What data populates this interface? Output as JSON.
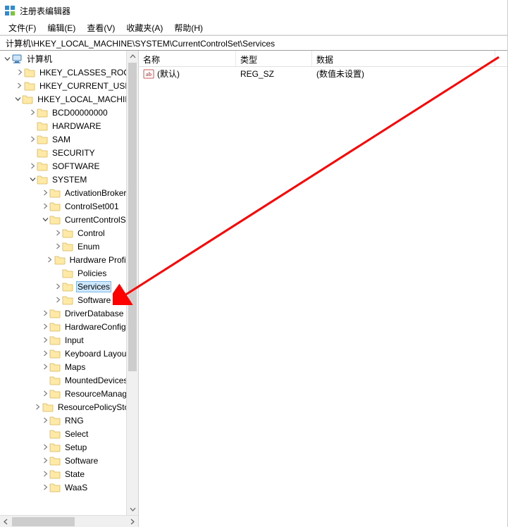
{
  "title": "注册表编辑器",
  "menubar": {
    "file": "文件(F)",
    "edit": "编辑(E)",
    "view": "查看(V)",
    "favorites": "收藏夹(A)",
    "help": "帮助(H)"
  },
  "address": "计算机\\HKEY_LOCAL_MACHINE\\SYSTEM\\CurrentControlSet\\Services",
  "tree": [
    {
      "depth": 0,
      "exp": "open",
      "icon": "computer",
      "label": "计算机"
    },
    {
      "depth": 1,
      "exp": "closed",
      "icon": "folder",
      "label": "HKEY_CLASSES_ROOT"
    },
    {
      "depth": 1,
      "exp": "closed",
      "icon": "folder",
      "label": "HKEY_CURRENT_USER"
    },
    {
      "depth": 1,
      "exp": "open",
      "icon": "folder",
      "label": "HKEY_LOCAL_MACHINE"
    },
    {
      "depth": 2,
      "exp": "closed",
      "icon": "folder",
      "label": "BCD00000000"
    },
    {
      "depth": 2,
      "exp": "none",
      "icon": "folder",
      "label": "HARDWARE"
    },
    {
      "depth": 2,
      "exp": "closed",
      "icon": "folder",
      "label": "SAM"
    },
    {
      "depth": 2,
      "exp": "none",
      "icon": "folder",
      "label": "SECURITY"
    },
    {
      "depth": 2,
      "exp": "closed",
      "icon": "folder",
      "label": "SOFTWARE"
    },
    {
      "depth": 2,
      "exp": "open",
      "icon": "folder",
      "label": "SYSTEM"
    },
    {
      "depth": 3,
      "exp": "closed",
      "icon": "folder",
      "label": "ActivationBroker"
    },
    {
      "depth": 3,
      "exp": "closed",
      "icon": "folder",
      "label": "ControlSet001"
    },
    {
      "depth": 3,
      "exp": "open",
      "icon": "folder",
      "label": "CurrentControlSet"
    },
    {
      "depth": 4,
      "exp": "closed",
      "icon": "folder",
      "label": "Control"
    },
    {
      "depth": 4,
      "exp": "closed",
      "icon": "folder",
      "label": "Enum"
    },
    {
      "depth": 4,
      "exp": "closed",
      "icon": "folder",
      "label": "Hardware Profiles"
    },
    {
      "depth": 4,
      "exp": "none",
      "icon": "folder",
      "label": "Policies"
    },
    {
      "depth": 4,
      "exp": "closed",
      "icon": "folder",
      "label": "Services",
      "selected": true
    },
    {
      "depth": 4,
      "exp": "closed",
      "icon": "folder",
      "label": "Software"
    },
    {
      "depth": 3,
      "exp": "closed",
      "icon": "folder",
      "label": "DriverDatabase"
    },
    {
      "depth": 3,
      "exp": "closed",
      "icon": "folder",
      "label": "HardwareConfig"
    },
    {
      "depth": 3,
      "exp": "closed",
      "icon": "folder",
      "label": "Input"
    },
    {
      "depth": 3,
      "exp": "closed",
      "icon": "folder",
      "label": "Keyboard Layout"
    },
    {
      "depth": 3,
      "exp": "closed",
      "icon": "folder",
      "label": "Maps"
    },
    {
      "depth": 3,
      "exp": "none",
      "icon": "folder",
      "label": "MountedDevices"
    },
    {
      "depth": 3,
      "exp": "closed",
      "icon": "folder",
      "label": "ResourceManager"
    },
    {
      "depth": 3,
      "exp": "closed",
      "icon": "folder",
      "label": "ResourcePolicyStore"
    },
    {
      "depth": 3,
      "exp": "closed",
      "icon": "folder",
      "label": "RNG"
    },
    {
      "depth": 3,
      "exp": "none",
      "icon": "folder",
      "label": "Select"
    },
    {
      "depth": 3,
      "exp": "closed",
      "icon": "folder",
      "label": "Setup"
    },
    {
      "depth": 3,
      "exp": "closed",
      "icon": "folder",
      "label": "Software"
    },
    {
      "depth": 3,
      "exp": "closed",
      "icon": "folder",
      "label": "State"
    },
    {
      "depth": 3,
      "exp": "closed",
      "icon": "folder",
      "label": "WaaS"
    }
  ],
  "columns": {
    "name": "名称",
    "type": "类型",
    "data": "数据"
  },
  "colwidths": {
    "name": 138,
    "type": 108,
    "data": 260
  },
  "values": [
    {
      "icon": "string",
      "name": "(默认)",
      "type": "REG_SZ",
      "data": "(数值未设置)"
    }
  ]
}
